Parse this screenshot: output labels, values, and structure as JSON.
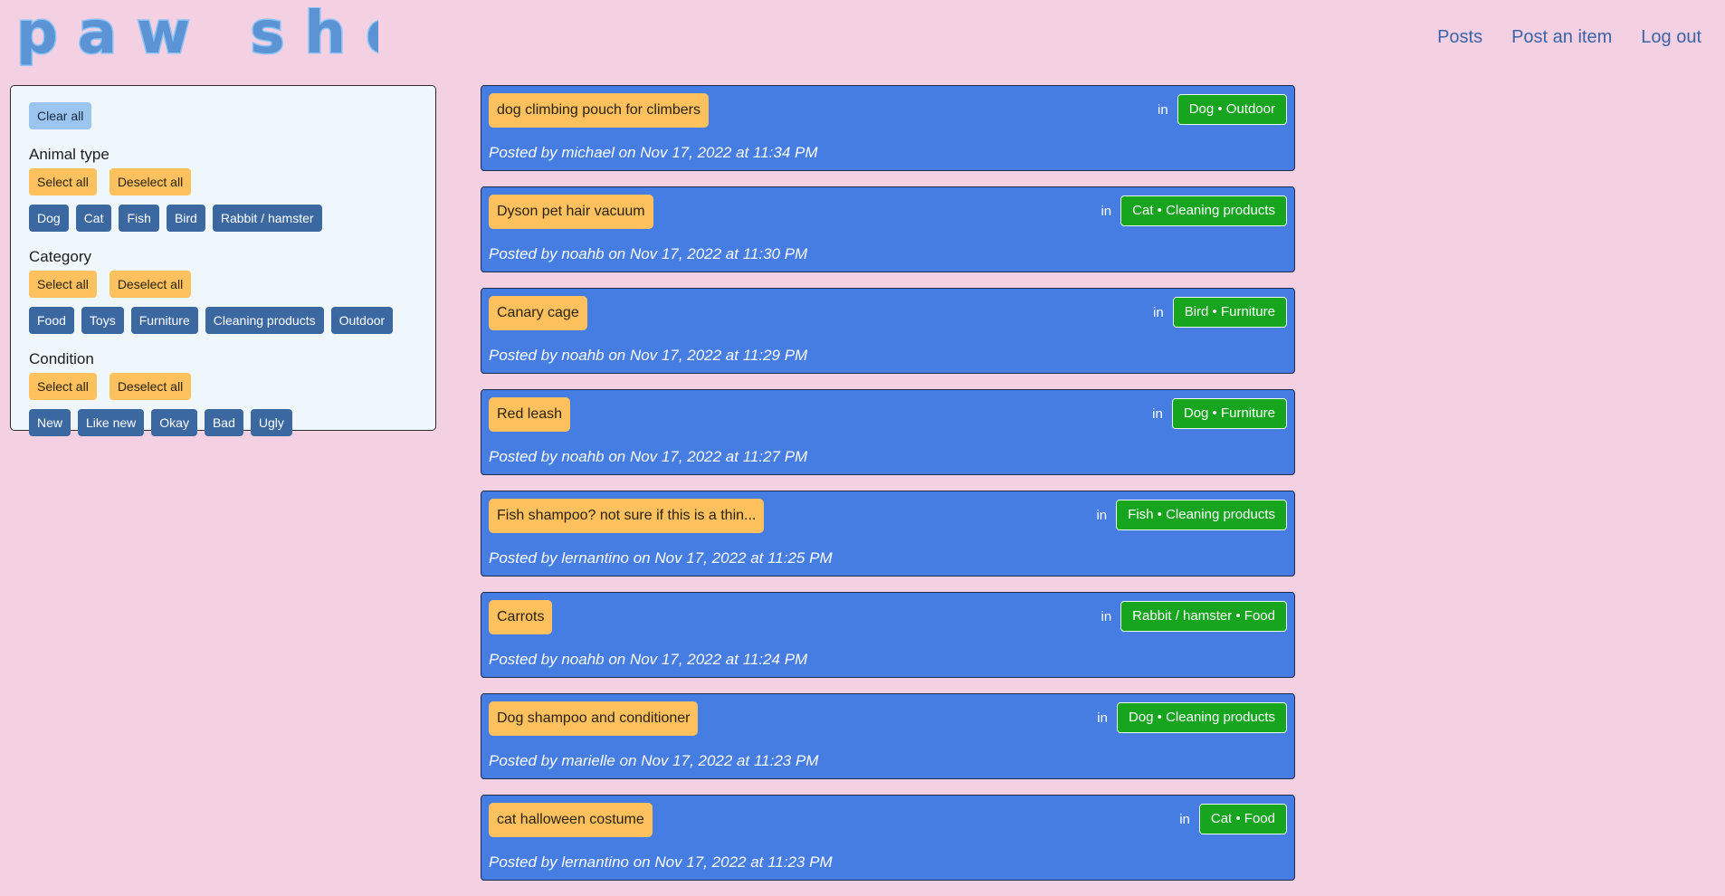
{
  "header": {
    "logo_text": "paw shop",
    "nav": [
      "Posts",
      "Post an item",
      "Log out"
    ]
  },
  "filters": {
    "clear_all": "Clear all",
    "select_all": "Select all",
    "deselect_all": "Deselect all",
    "animal_type": {
      "title": "Animal type",
      "options": [
        "Dog",
        "Cat",
        "Fish",
        "Bird",
        "Rabbit / hamster"
      ]
    },
    "category": {
      "title": "Category",
      "options": [
        "Food",
        "Toys",
        "Furniture",
        "Cleaning products",
        "Outdoor"
      ]
    },
    "condition": {
      "title": "Condition",
      "options": [
        "New",
        "Like new",
        "Okay",
        "Bad",
        "Ugly"
      ]
    }
  },
  "posts": [
    {
      "title": "dog climbing pouch for climbers",
      "in": "in",
      "tag": "Dog • Outdoor",
      "meta": "Posted by michael on Nov 17, 2022 at 11:34 PM"
    },
    {
      "title": "Dyson pet hair vacuum",
      "in": "in",
      "tag": "Cat • Cleaning products",
      "meta": "Posted by noahb on Nov 17, 2022 at 11:30 PM"
    },
    {
      "title": "Canary cage",
      "in": "in",
      "tag": "Bird • Furniture",
      "meta": "Posted by noahb on Nov 17, 2022 at 11:29 PM"
    },
    {
      "title": "Red leash",
      "in": "in",
      "tag": "Dog • Furniture",
      "meta": "Posted by noahb on Nov 17, 2022 at 11:27 PM"
    },
    {
      "title": "Fish shampoo? not sure if this is a thin...",
      "in": "in",
      "tag": "Fish • Cleaning products",
      "meta": "Posted by lernantino on Nov 17, 2022 at 11:25 PM"
    },
    {
      "title": "Carrots",
      "in": "in",
      "tag": "Rabbit / hamster • Food",
      "meta": "Posted by noahb on Nov 17, 2022 at 11:24 PM"
    },
    {
      "title": "Dog shampoo and conditioner",
      "in": "in",
      "tag": "Dog • Cleaning products",
      "meta": "Posted by marielle on Nov 17, 2022 at 11:23 PM"
    },
    {
      "title": "cat halloween costume",
      "in": "in",
      "tag": "Cat • Food",
      "meta": "Posted by lernantino on Nov 17, 2022 at 11:23 PM"
    }
  ],
  "colors": {
    "background": "#f3d0e2",
    "post_card": "#467de2",
    "accent_yellow": "#ffc05e",
    "tag_green": "#17a51f",
    "filter_blue": "#3b68a0"
  }
}
